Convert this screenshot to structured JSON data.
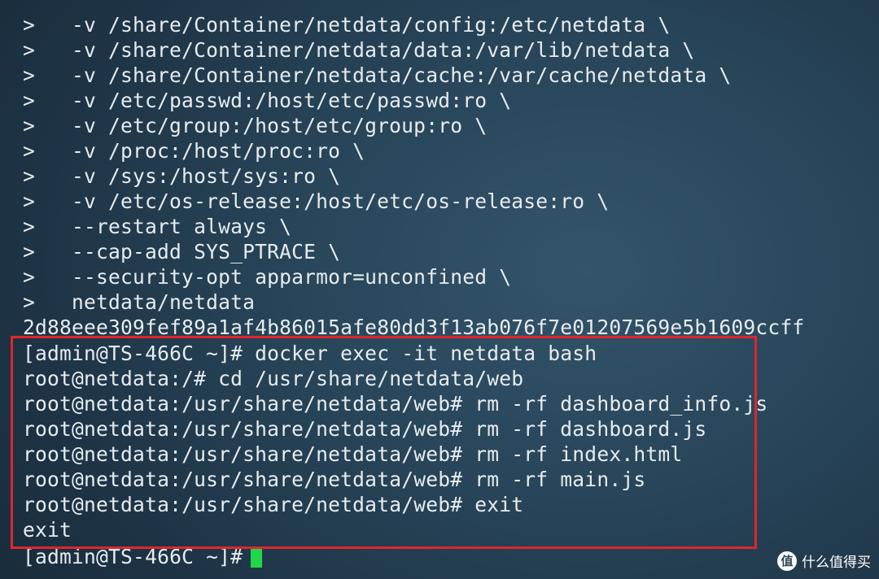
{
  "terminal": {
    "lines": [
      {
        "prefix": ">",
        "text": "-v /share/Container/netdata/config:/etc/netdata \\"
      },
      {
        "prefix": ">",
        "text": "-v /share/Container/netdata/data:/var/lib/netdata \\"
      },
      {
        "prefix": ">",
        "text": "-v /share/Container/netdata/cache:/var/cache/netdata \\"
      },
      {
        "prefix": ">",
        "text": "-v /etc/passwd:/host/etc/passwd:ro \\"
      },
      {
        "prefix": ">",
        "text": "-v /etc/group:/host/etc/group:ro \\"
      },
      {
        "prefix": ">",
        "text": "-v /proc:/host/proc:ro \\"
      },
      {
        "prefix": ">",
        "text": "-v /sys:/host/sys:ro \\"
      },
      {
        "prefix": ">",
        "text": "-v /etc/os-release:/host/etc/os-release:ro \\"
      },
      {
        "prefix": ">",
        "text": "--restart always \\"
      },
      {
        "prefix": ">",
        "text": "--cap-add SYS_PTRACE \\"
      },
      {
        "prefix": ">",
        "text": "--security-opt apparmor=unconfined \\"
      },
      {
        "prefix": ">",
        "text": "netdata/netdata"
      },
      {
        "prefix": "",
        "text": "2d88eee309fef89a1af4b86015afe80dd3f13ab076f7e01207569e5b1609ccff"
      },
      {
        "prefix": "",
        "text": "[admin@TS-466C ~]# docker exec -it netdata bash"
      },
      {
        "prefix": "",
        "text": "root@netdata:/# cd /usr/share/netdata/web"
      },
      {
        "prefix": "",
        "text": "root@netdata:/usr/share/netdata/web# rm -rf dashboard_info.js"
      },
      {
        "prefix": "",
        "text": "root@netdata:/usr/share/netdata/web# rm -rf dashboard.js"
      },
      {
        "prefix": "",
        "text": "root@netdata:/usr/share/netdata/web# rm -rf index.html"
      },
      {
        "prefix": "",
        "text": "root@netdata:/usr/share/netdata/web# rm -rf main.js"
      },
      {
        "prefix": "",
        "text": "root@netdata:/usr/share/netdata/web# exit"
      },
      {
        "prefix": "",
        "text": "exit"
      },
      {
        "prefix": "",
        "text": "[admin@TS-466C ~]#"
      }
    ]
  },
  "colors": {
    "text": "#e6ecef",
    "highlight_border": "#e0262b",
    "cursor": "#22d64a"
  },
  "watermark": {
    "logo": "值",
    "text": "什么值得买"
  }
}
